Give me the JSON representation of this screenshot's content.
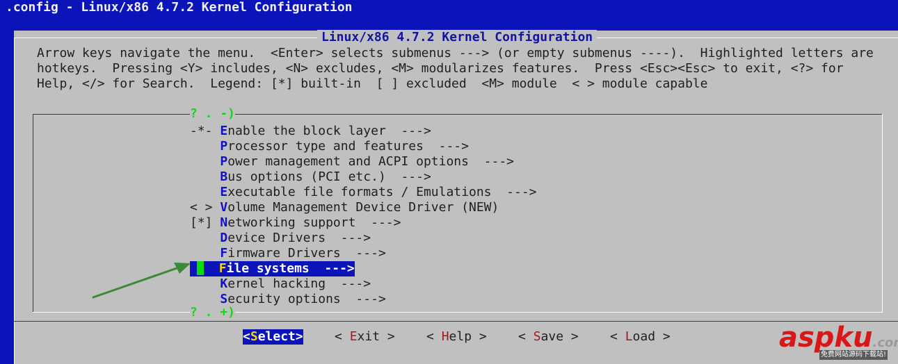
{
  "window_title": ".config - Linux/x86 4.7.2 Kernel Configuration",
  "dialog": {
    "title": "Linux/x86 4.7.2 Kernel Configuration",
    "help_lines": [
      "Arrow keys navigate the menu.  <Enter> selects submenus ---> (or empty submenus ----).  Highlighted letters are",
      "hotkeys.  Pressing <Y> includes, <N> excludes, <M> modularizes features.  Press <Esc><Esc> to exit, <?> for",
      "Help, </> for Search.  Legend: [*] built-in  [ ] excluded  <M> module  < > module capable"
    ]
  },
  "menu": {
    "scroll_up_hint": "? . -)",
    "scroll_down_hint": "? . +)",
    "items": [
      {
        "prefix": "-*- ",
        "hotkey": "E",
        "label": "nable the block layer  --->"
      },
      {
        "prefix": "    ",
        "hotkey": "P",
        "label": "rocessor type and features  --->"
      },
      {
        "prefix": "    ",
        "hotkey": "P",
        "label": "ower management and ACPI options  --->"
      },
      {
        "prefix": "    ",
        "hotkey": "B",
        "label": "us options (PCI etc.)  --->"
      },
      {
        "prefix": "    ",
        "hotkey": "E",
        "label": "xecutable file formats / Emulations  --->"
      },
      {
        "prefix": "< > ",
        "hotkey": "V",
        "label": "olume Management Device Driver (NEW)"
      },
      {
        "prefix": "[*] ",
        "hotkey": "N",
        "label": "etworking support  --->"
      },
      {
        "prefix": "    ",
        "hotkey": "D",
        "label": "evice Drivers  --->"
      },
      {
        "prefix": "    ",
        "hotkey": "F",
        "label": "irmware Drivers  --->"
      },
      {
        "prefix": "    ",
        "hotkey": "F",
        "label": "ile systems  --->"
      },
      {
        "prefix": "    ",
        "hotkey": "K",
        "label": "ernel hacking  --->"
      },
      {
        "prefix": "    ",
        "hotkey": "S",
        "label": "ecurity options  --->"
      }
    ],
    "selected_index": 9
  },
  "buttons": [
    {
      "open": "<",
      "hotkey": "S",
      "rest": "elect",
      "close": ">"
    },
    {
      "open": "< ",
      "hotkey": "E",
      "rest": "xit",
      "close": " >"
    },
    {
      "open": "< ",
      "hotkey": "H",
      "rest": "elp",
      "close": " >"
    },
    {
      "open": "< ",
      "hotkey": "S",
      "rest": "ave",
      "close": " >"
    },
    {
      "open": "< ",
      "hotkey": "L",
      "rest": "oad",
      "close": " >"
    }
  ],
  "watermark": {
    "brand": "aspku",
    "tld": ".com",
    "tagline": "免费网站源码下载站!"
  },
  "colors": {
    "background_blue": "#0a14b8",
    "dialog_gray": "#c0c0c0",
    "hotkey_blue": "#1010c8",
    "hotkey_red": "#b01414",
    "hint_green": "#16d616",
    "selected_hotkey_yellow": "#f5d800",
    "arrow_green": "#3a8a3a",
    "watermark_red": "#d81818"
  }
}
